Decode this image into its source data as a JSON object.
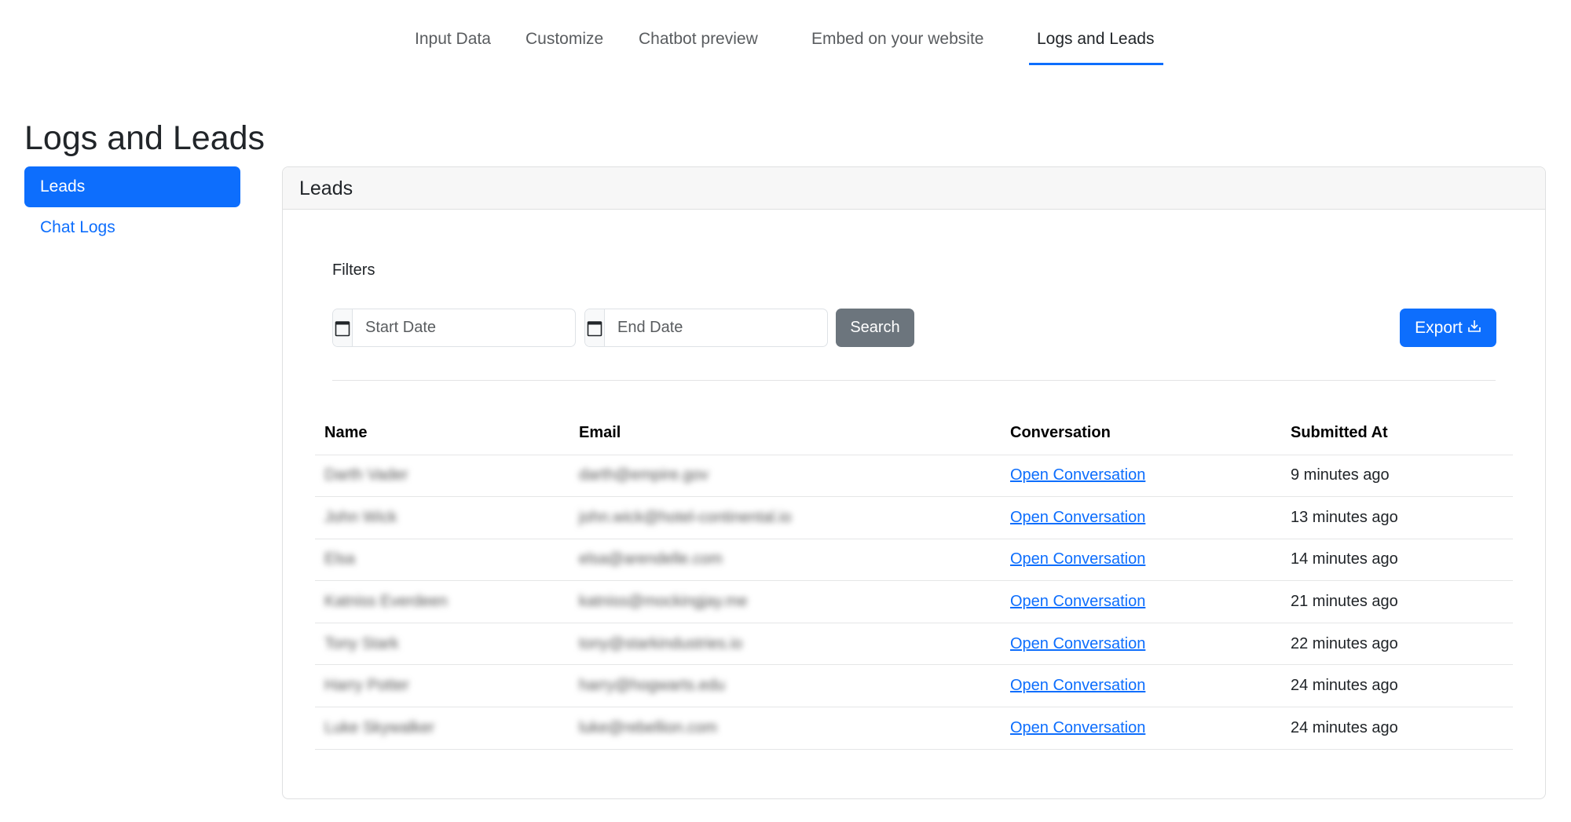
{
  "nav": {
    "tabs": [
      {
        "label": "Input Data",
        "active": false
      },
      {
        "label": "Customize",
        "active": false
      },
      {
        "label": "Chatbot preview",
        "active": false
      },
      {
        "label": "Embed on your website",
        "active": false
      },
      {
        "label": "Logs and Leads",
        "active": true
      }
    ]
  },
  "page": {
    "title": "Logs and Leads"
  },
  "sidebar": {
    "items": [
      {
        "label": "Leads",
        "active": true
      },
      {
        "label": "Chat Logs",
        "active": false
      }
    ]
  },
  "card": {
    "title": "Leads",
    "filters_label": "Filters",
    "start_date_placeholder": "Start Date",
    "end_date_placeholder": "End Date",
    "search_label": "Search",
    "export_label": "Export"
  },
  "table": {
    "headers": [
      "Name",
      "Email",
      "Conversation",
      "Submitted At"
    ],
    "rows": [
      {
        "name": "Darth Vader",
        "email": "darth@empire.gov",
        "conversation": "Open Conversation",
        "submitted": "9 minutes ago"
      },
      {
        "name": "John Wick",
        "email": "john.wick@hotel-continental.io",
        "conversation": "Open Conversation",
        "submitted": "13 minutes ago"
      },
      {
        "name": "Elsa",
        "email": "elsa@arendelle.com",
        "conversation": "Open Conversation",
        "submitted": "14 minutes ago"
      },
      {
        "name": "Katniss Everdeen",
        "email": "katniss@mockingjay.me",
        "conversation": "Open Conversation",
        "submitted": "21 minutes ago"
      },
      {
        "name": "Tony Stark",
        "email": "tony@starkindustries.io",
        "conversation": "Open Conversation",
        "submitted": "22 minutes ago"
      },
      {
        "name": "Harry Potter",
        "email": "harry@hogwarts.edu",
        "conversation": "Open Conversation",
        "submitted": "24 minutes ago"
      },
      {
        "name": "Luke Skywalker",
        "email": "luke@rebellion.com",
        "conversation": "Open Conversation",
        "submitted": "24 minutes ago"
      }
    ]
  },
  "colors": {
    "primary": "#0d6efd",
    "secondary": "#6c757d"
  }
}
